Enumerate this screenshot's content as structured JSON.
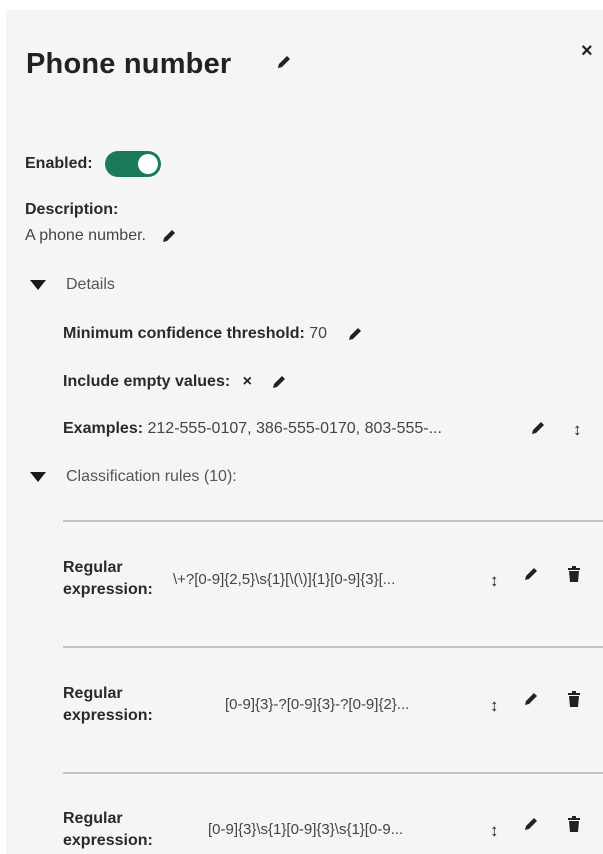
{
  "header": {
    "title": "Phone number",
    "close_label": "×"
  },
  "enabled": {
    "label": "Enabled:",
    "value": true
  },
  "description": {
    "label": "Description:",
    "text": "A phone number."
  },
  "details": {
    "toggle_label": "Details",
    "min_confidence": {
      "label": "Minimum confidence threshold:",
      "value": "70"
    },
    "include_empty": {
      "label": "Include empty values:",
      "value": "×"
    },
    "examples": {
      "label": "Examples:",
      "value": "212-555-0107, 386-555-0170, 803-555-...",
      "updown": "↕"
    }
  },
  "classification_rules": {
    "toggle_label": "Classification rules (10):",
    "rules": [
      {
        "label_line1": "Regular",
        "label_line2": "expression:",
        "value": "\\+?[0-9]{2,5}\\s{1}[\\(\\)]{1}[0-9]{3}[...",
        "updown": "↕"
      },
      {
        "label_line1": "Regular",
        "label_line2": "expression:",
        "value": "[0-9]{3}-?[0-9]{3}-?[0-9]{2}...",
        "updown": "↕"
      },
      {
        "label_line1": "Regular",
        "label_line2": "expression:",
        "value": "[0-9]{3}\\s{1}[0-9]{3}\\s{1}[0-9...",
        "updown": "↕"
      }
    ]
  },
  "colors": {
    "toggle_on": "#1b7a5a",
    "panel_bg": "#f5f5f5",
    "divider": "#c4c4c4"
  },
  "icons": {
    "edit": "pencil-icon",
    "delete": "trash-icon",
    "reorder": "up-down-arrow-icon",
    "collapse": "caret-down-icon",
    "close": "close-icon"
  }
}
